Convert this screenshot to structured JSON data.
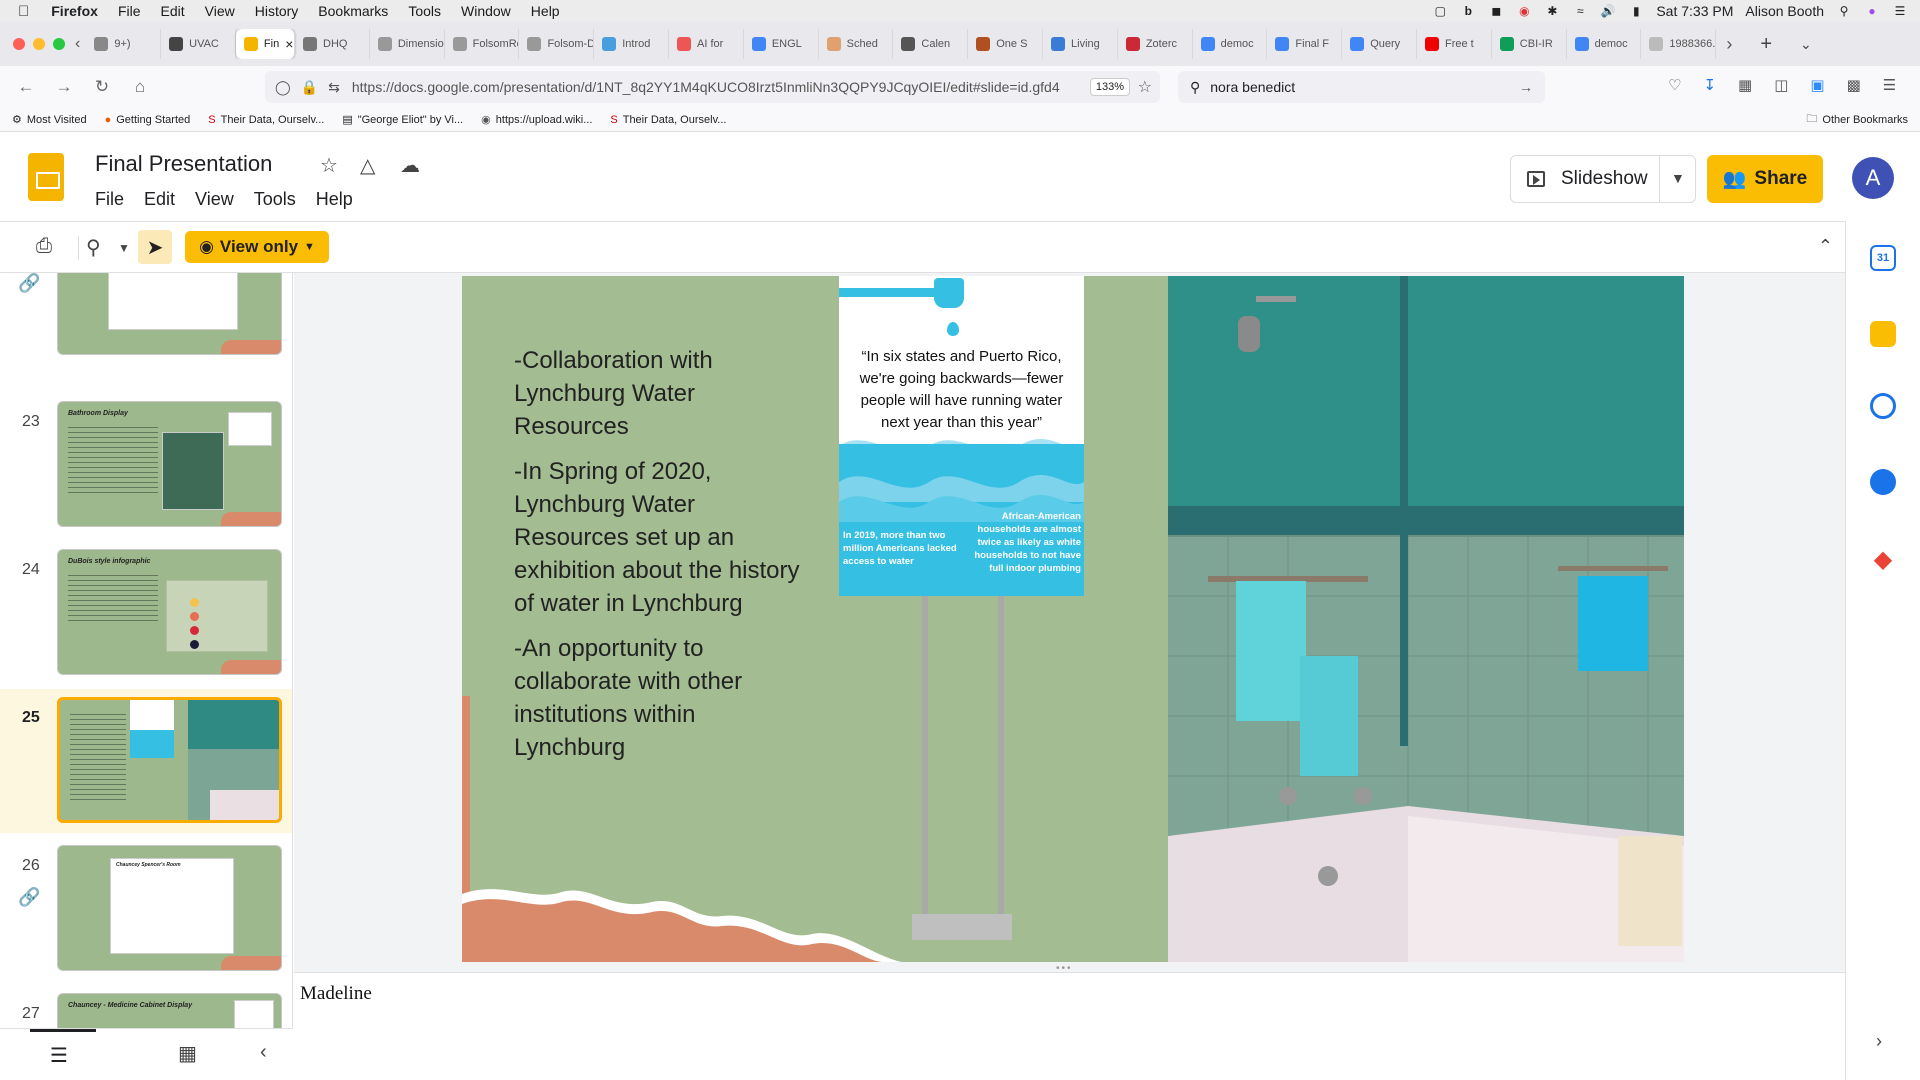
{
  "system_menu": {
    "app_name": "Firefox",
    "items": [
      "File",
      "Edit",
      "View",
      "History",
      "Bookmarks",
      "Tools",
      "Window",
      "Help"
    ],
    "clock": "Sat 7:33 PM",
    "user": "Alison Booth"
  },
  "tabs": [
    {
      "label": "9+)",
      "color": "#888"
    },
    {
      "label": "UVAC",
      "color": "#444"
    },
    {
      "label": "Fin",
      "color": "#f4b400",
      "active": true
    },
    {
      "label": "DHQ",
      "color": "#777"
    },
    {
      "label": "Dimension",
      "color": "#999"
    },
    {
      "label": "FolsomRe",
      "color": "#999"
    },
    {
      "label": "Folsom-D",
      "color": "#999"
    },
    {
      "label": "Introd",
      "color": "#4b9ede"
    },
    {
      "label": "AI for",
      "color": "#e55"
    },
    {
      "label": "ENGL",
      "color": "#4285f4"
    },
    {
      "label": "Sched",
      "color": "#e0a070"
    },
    {
      "label": "Calen",
      "color": "#555"
    },
    {
      "label": "One S",
      "color": "#b05020"
    },
    {
      "label": "Living",
      "color": "#3a7bd5"
    },
    {
      "label": "Zoterc",
      "color": "#cc2936"
    },
    {
      "label": "democ",
      "color": "#4285f4"
    },
    {
      "label": "Final F",
      "color": "#4285f4"
    },
    {
      "label": "Query",
      "color": "#4285f4"
    },
    {
      "label": "Free t",
      "color": "#e00"
    },
    {
      "label": "CBI-IR",
      "color": "#0f9d58"
    },
    {
      "label": "democ",
      "color": "#4285f4"
    },
    {
      "label": "1988366.",
      "color": "#bbb"
    }
  ],
  "nav": {
    "url": "https://docs.google.com/presentation/d/1NT_8q2YY1M4qKUCO8Irzt5InmliNn3QQPY9JCqyOIEI/edit#slide=id.gfd4",
    "zoom": "133%",
    "search_value": "nora benedict"
  },
  "bookmarks": {
    "items": [
      "Most Visited",
      "Getting Started",
      "Their Data, Ourselv...",
      "\"George Eliot\" by Vi...",
      "https://upload.wiki...",
      "Their Data, Ourselv..."
    ],
    "other": "Other Bookmarks"
  },
  "doc": {
    "title": "Final Presentation",
    "menu": [
      "File",
      "Edit",
      "View",
      "Tools",
      "Help"
    ],
    "slideshow_label": "Slideshow",
    "share_label": "Share",
    "avatar_letter": "A",
    "view_only_label": "View only"
  },
  "filmstrip": [
    {
      "num": "",
      "title": ""
    },
    {
      "num": "23",
      "title": "Bathroom Display"
    },
    {
      "num": "24",
      "title": "DuBois style infographic"
    },
    {
      "num": "25",
      "title": "",
      "current": true
    },
    {
      "num": "26",
      "title": "Chauncey Spencer's Room"
    },
    {
      "num": "27",
      "title": "Chauncey - Medicine Cabinet Display"
    }
  ],
  "slide": {
    "bullets": [
      "-Collaboration with Lynchburg Water Resources",
      "-In Spring of 2020, Lynchburg Water Resources set up an exhibition about the history of water in Lynchburg",
      "-An opportunity to collaborate with other institutions within Lynchburg"
    ],
    "sign_quote": "“In six states and Puerto Rico, we're going backwards—fewer people will have running water next year than this year”",
    "sign_left": "In 2019, more than two million Americans lacked access to water",
    "sign_right": "African-American households are almost twice as likely as white households to not have full indoor plumbing"
  },
  "notes": {
    "text": "Madeline"
  }
}
